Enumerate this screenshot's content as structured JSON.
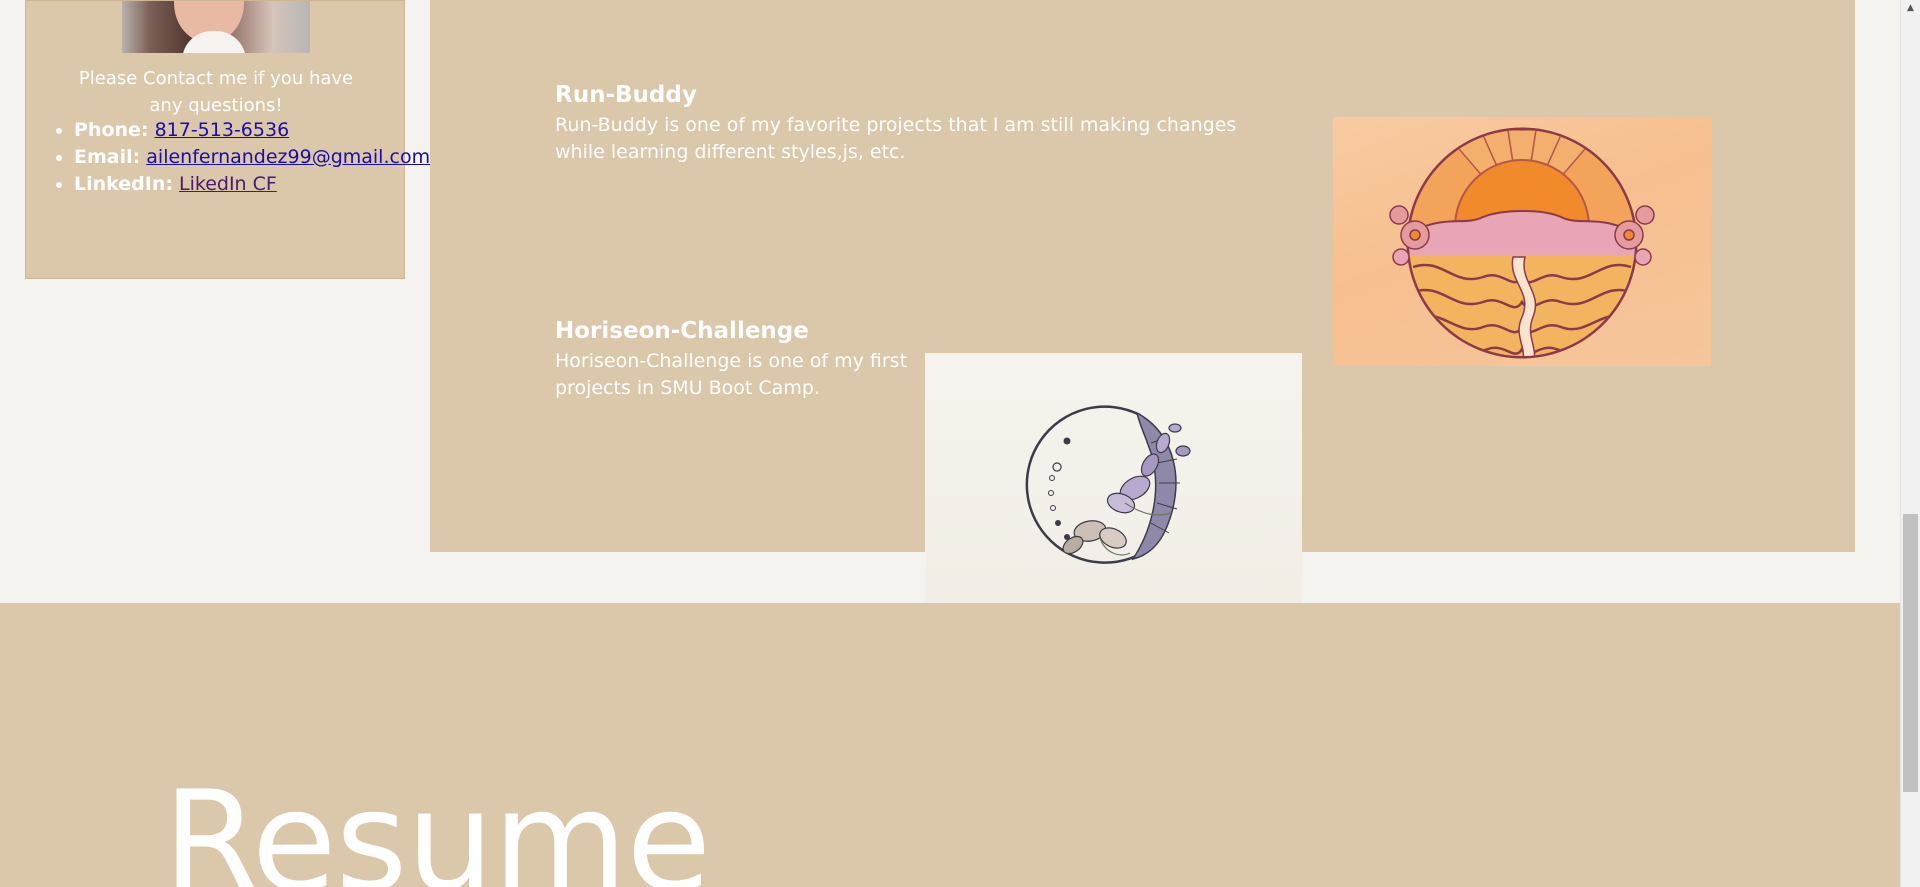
{
  "contact": {
    "intro": "Please Contact me if you have any questions!",
    "phone_label": "Phone:",
    "phone_value": "817-513-6536",
    "email_label": "Email:",
    "email_value": "ailenfernandez99@gmail.com",
    "linkedin_label": "LinkedIn:",
    "linkedin_value": "LikedIn CF"
  },
  "projects": [
    {
      "title": "Run-Buddy",
      "description": "Run-Buddy is one of my favorite projects that I am still making changes while learning different styles,js, etc.",
      "image_icon": "sunset-illustration-icon"
    },
    {
      "title": "Horiseon-Challenge",
      "description": "Horiseon-Challenge is one of my first projects in SMU Boot Camp.",
      "image_icon": "moon-wreath-illustration-icon"
    }
  ],
  "resume": {
    "heading": "Resume"
  },
  "colors": {
    "panel": "#dbc7a9",
    "page_background": "#f4f3f0",
    "text": "#ffffff",
    "link": "#1a0dab",
    "visited_link": "#4b1a6e"
  }
}
